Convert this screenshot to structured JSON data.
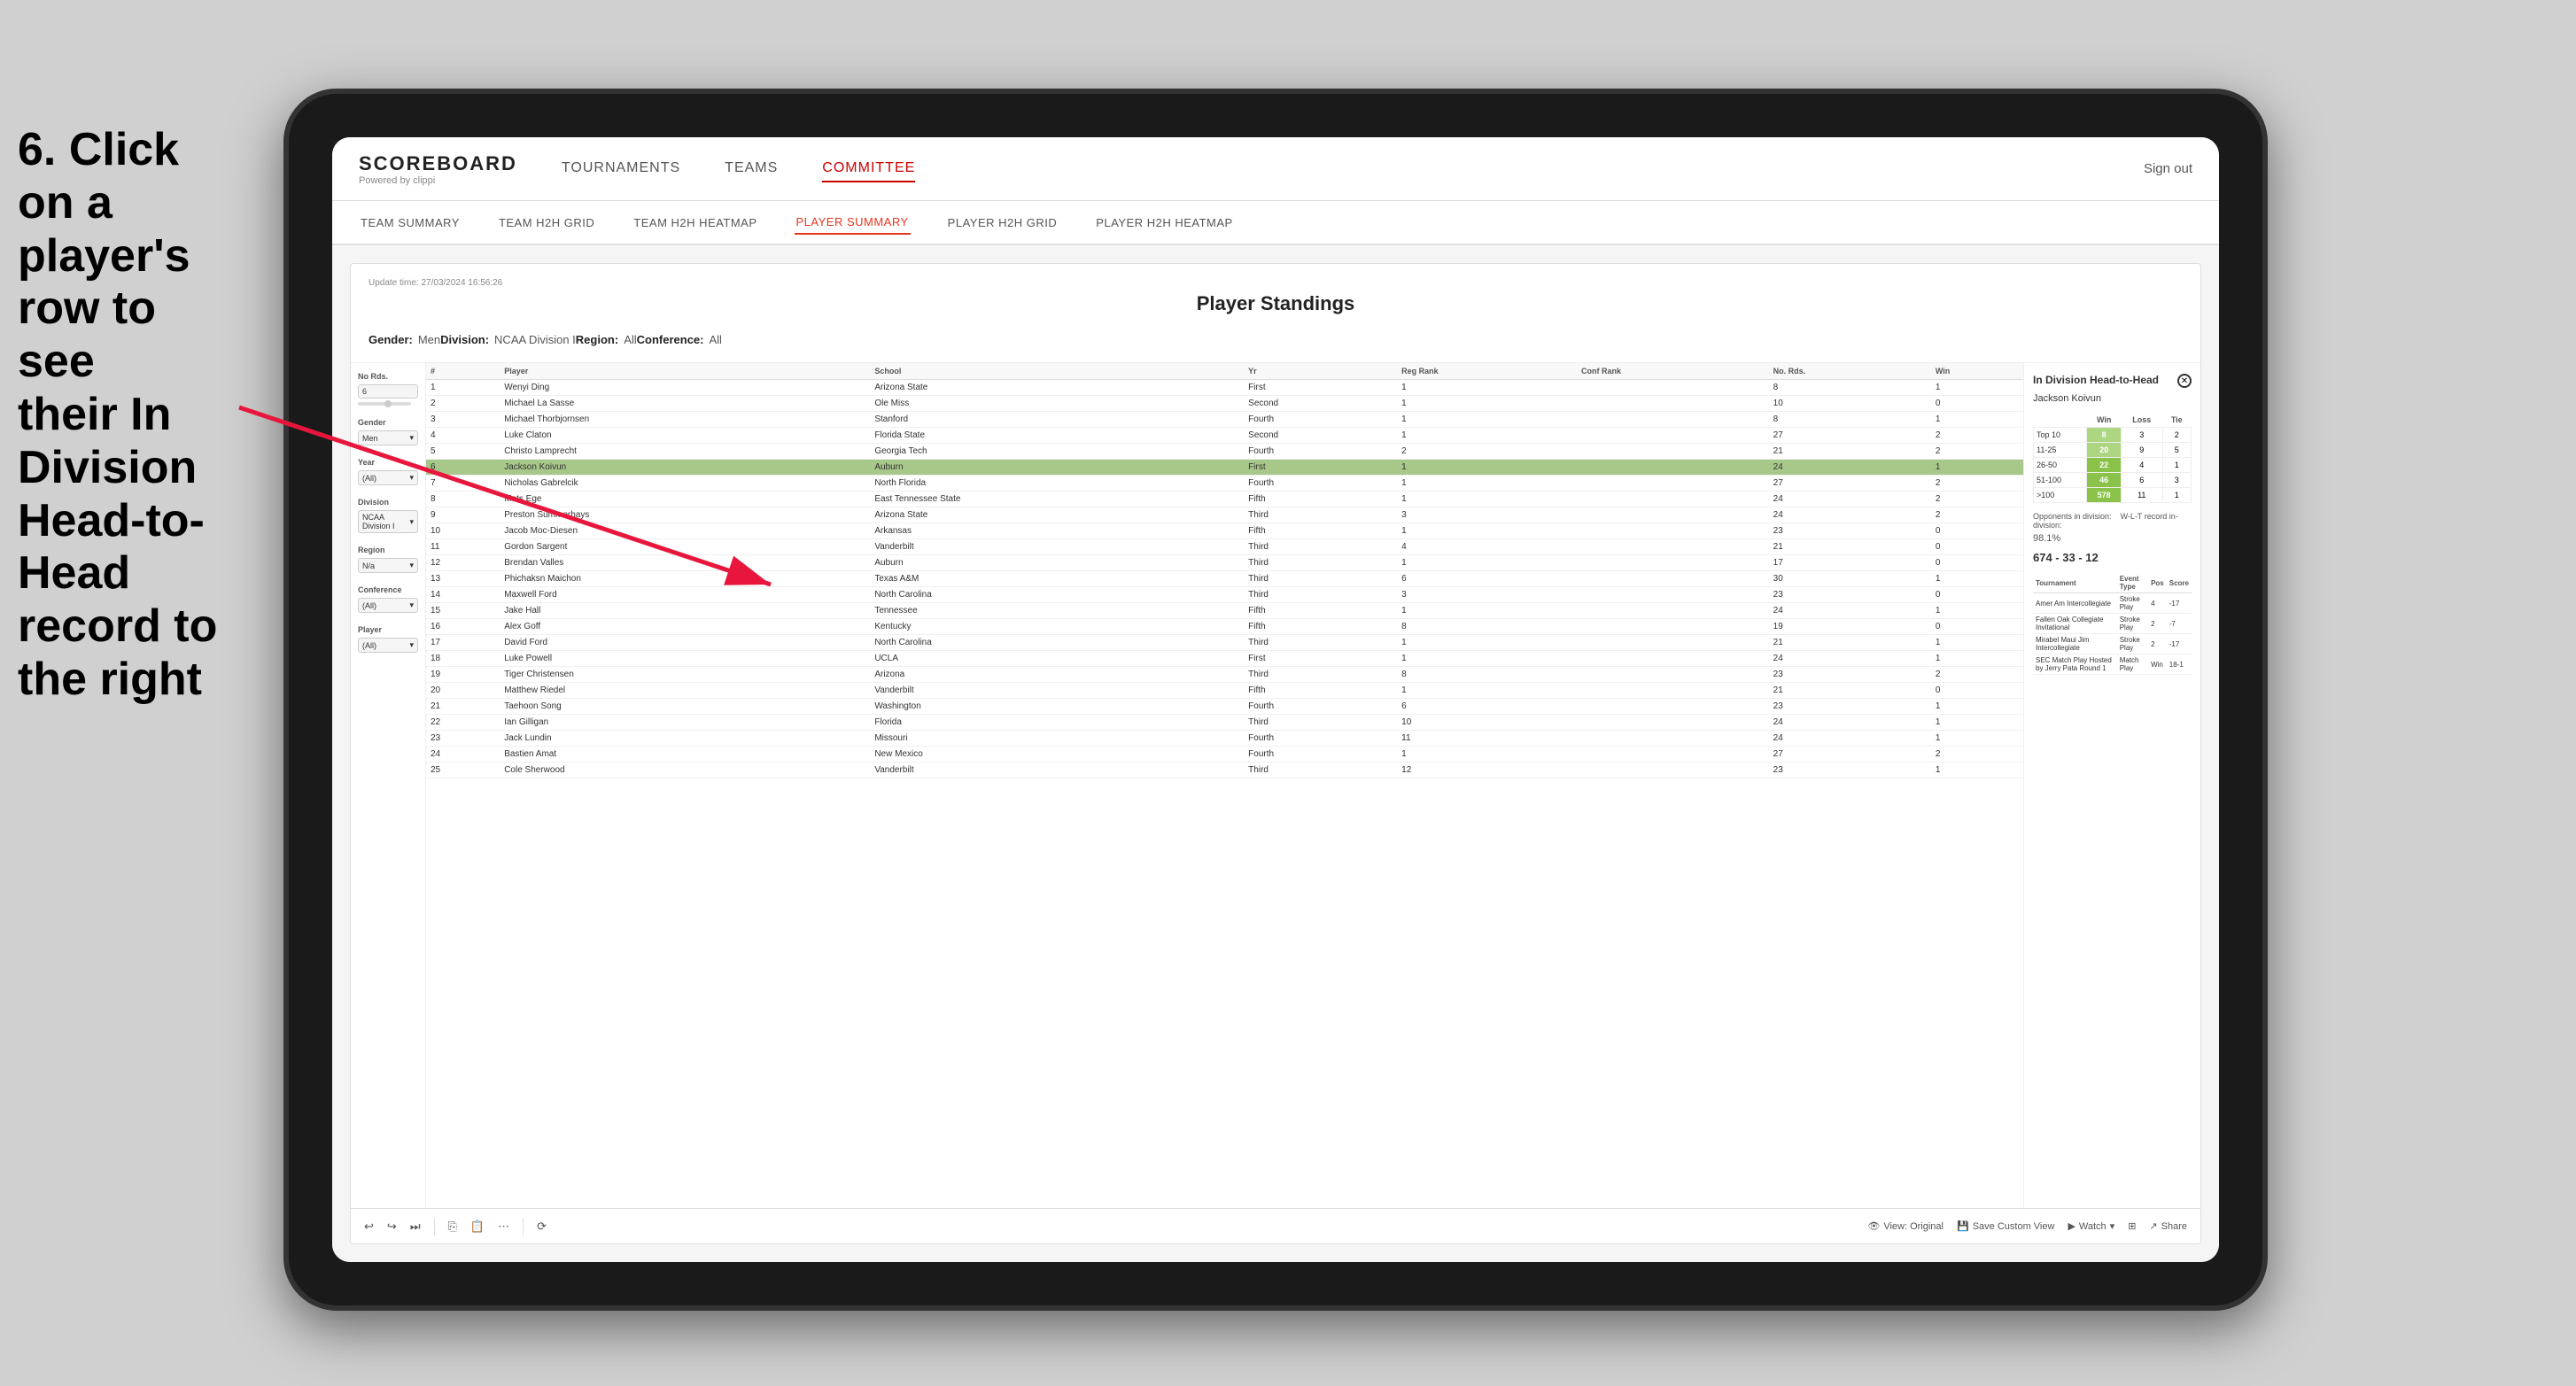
{
  "instruction": {
    "line1": "6. Click on a",
    "line2": "player's row to see",
    "line3": "their In Division",
    "line4": "Head-to-Head",
    "line5": "record to the right"
  },
  "nav": {
    "logo": "SCOREBOARD",
    "logo_sub": "Powered by clippi",
    "items": [
      "TOURNAMENTS",
      "TEAMS",
      "COMMITTEE"
    ],
    "sign_out": "Sign out"
  },
  "sub_nav": {
    "items": [
      "TEAM SUMMARY",
      "TEAM H2H GRID",
      "TEAM H2H HEATMAP",
      "PLAYER SUMMARY",
      "PLAYER H2H GRID",
      "PLAYER H2H HEATMAP"
    ]
  },
  "dashboard": {
    "update_time": "Update time:",
    "update_date": "27/03/2024 16:56:26",
    "title": "Player Standings",
    "gender_label": "Gender:",
    "gender_value": "Men",
    "division_label": "Division:",
    "division_value": "NCAA Division I",
    "region_label": "Region:",
    "region_value": "All",
    "conference_label": "Conference:",
    "conference_value": "All"
  },
  "sidebar": {
    "no_rds_label": "No Rds.",
    "no_rds_value": "6",
    "gender_label": "Gender",
    "gender_value": "Men",
    "year_label": "Year",
    "year_value": "(All)",
    "division_label": "Division",
    "division_value": "NCAA Division I",
    "region_label": "Region",
    "region_value": "N/a",
    "conference_label": "Conference",
    "conference_value": "(All)",
    "player_label": "Player",
    "player_value": "(All)"
  },
  "table": {
    "headers": [
      "#",
      "Player",
      "School",
      "Yr",
      "Reg Rank",
      "Conf Rank",
      "No. Rds.",
      "Win"
    ],
    "rows": [
      {
        "rank": 1,
        "player": "Wenyi Ding",
        "school": "Arizona State",
        "yr": "First",
        "reg_rank": 1,
        "conf_rank": "",
        "no_rds": 8,
        "win": 1
      },
      {
        "rank": 2,
        "player": "Michael La Sasse",
        "school": "Ole Miss",
        "yr": "Second",
        "reg_rank": 1,
        "conf_rank": "",
        "no_rds": 10,
        "win": 0
      },
      {
        "rank": 3,
        "player": "Michael Thorbjornsen",
        "school": "Stanford",
        "yr": "Fourth",
        "reg_rank": 1,
        "conf_rank": "",
        "no_rds": 8,
        "win": 1
      },
      {
        "rank": 4,
        "player": "Luke Claton",
        "school": "Florida State",
        "yr": "Second",
        "reg_rank": 1,
        "conf_rank": "",
        "no_rds": 27,
        "win": 2
      },
      {
        "rank": 5,
        "player": "Christo Lamprecht",
        "school": "Georgia Tech",
        "yr": "Fourth",
        "reg_rank": 2,
        "conf_rank": "",
        "no_rds": 21,
        "win": 2
      },
      {
        "rank": 6,
        "player": "Jackson Koivun",
        "school": "Auburn",
        "yr": "First",
        "reg_rank": 1,
        "conf_rank": "",
        "no_rds": 24,
        "win": 1,
        "selected": true
      },
      {
        "rank": 7,
        "player": "Nicholas Gabrelcik",
        "school": "North Florida",
        "yr": "Fourth",
        "reg_rank": 1,
        "conf_rank": "",
        "no_rds": 27,
        "win": 2
      },
      {
        "rank": 8,
        "player": "Mats Ege",
        "school": "East Tennessee State",
        "yr": "Fifth",
        "reg_rank": 1,
        "conf_rank": "",
        "no_rds": 24,
        "win": 2
      },
      {
        "rank": 9,
        "player": "Preston Summerhays",
        "school": "Arizona State",
        "yr": "Third",
        "reg_rank": 3,
        "conf_rank": "",
        "no_rds": 24,
        "win": 2
      },
      {
        "rank": 10,
        "player": "Jacob Moc-Diesen",
        "school": "Arkansas",
        "yr": "Fifth",
        "reg_rank": 1,
        "conf_rank": "",
        "no_rds": 23,
        "win": 0
      },
      {
        "rank": 11,
        "player": "Gordon Sargent",
        "school": "Vanderbilt",
        "yr": "Third",
        "reg_rank": 4,
        "conf_rank": "",
        "no_rds": 21,
        "win": 0
      },
      {
        "rank": 12,
        "player": "Brendan Valles",
        "school": "Auburn",
        "yr": "Third",
        "reg_rank": 1,
        "conf_rank": "",
        "no_rds": 17,
        "win": 0
      },
      {
        "rank": 13,
        "player": "Phichaksn Maichon",
        "school": "Texas A&M",
        "yr": "Third",
        "reg_rank": 6,
        "conf_rank": "",
        "no_rds": 30,
        "win": 1
      },
      {
        "rank": 14,
        "player": "Maxwell Ford",
        "school": "North Carolina",
        "yr": "Third",
        "reg_rank": 3,
        "conf_rank": "",
        "no_rds": 23,
        "win": 0
      },
      {
        "rank": 15,
        "player": "Jake Hall",
        "school": "Tennessee",
        "yr": "Fifth",
        "reg_rank": 1,
        "conf_rank": "",
        "no_rds": 24,
        "win": 1
      },
      {
        "rank": 16,
        "player": "Alex Goff",
        "school": "Kentucky",
        "yr": "Fifth",
        "reg_rank": 8,
        "conf_rank": "",
        "no_rds": 19,
        "win": 0
      },
      {
        "rank": 17,
        "player": "David Ford",
        "school": "North Carolina",
        "yr": "Third",
        "reg_rank": 1,
        "conf_rank": "",
        "no_rds": 21,
        "win": 1
      },
      {
        "rank": 18,
        "player": "Luke Powell",
        "school": "UCLA",
        "yr": "First",
        "reg_rank": 1,
        "conf_rank": "",
        "no_rds": 24,
        "win": 1
      },
      {
        "rank": 19,
        "player": "Tiger Christensen",
        "school": "Arizona",
        "yr": "Third",
        "reg_rank": 8,
        "conf_rank": "",
        "no_rds": 23,
        "win": 2
      },
      {
        "rank": 20,
        "player": "Matthew Riedel",
        "school": "Vanderbilt",
        "yr": "Fifth",
        "reg_rank": 1,
        "conf_rank": "",
        "no_rds": 21,
        "win": 0
      },
      {
        "rank": 21,
        "player": "Taehoon Song",
        "school": "Washington",
        "yr": "Fourth",
        "reg_rank": 6,
        "conf_rank": "",
        "no_rds": 23,
        "win": 1
      },
      {
        "rank": 22,
        "player": "Ian Gilligan",
        "school": "Florida",
        "yr": "Third",
        "reg_rank": 10,
        "conf_rank": "",
        "no_rds": 24,
        "win": 1
      },
      {
        "rank": 23,
        "player": "Jack Lundin",
        "school": "Missouri",
        "yr": "Fourth",
        "reg_rank": 11,
        "conf_rank": "",
        "no_rds": 24,
        "win": 1
      },
      {
        "rank": 24,
        "player": "Bastien Amat",
        "school": "New Mexico",
        "yr": "Fourth",
        "reg_rank": 1,
        "conf_rank": "",
        "no_rds": 27,
        "win": 2
      },
      {
        "rank": 25,
        "player": "Cole Sherwood",
        "school": "Vanderbilt",
        "yr": "Third",
        "reg_rank": 12,
        "conf_rank": "",
        "no_rds": 23,
        "win": 1
      }
    ]
  },
  "h2h_panel": {
    "title": "In Division Head-to-Head",
    "player_name": "Jackson Koivun",
    "table": {
      "headers": [
        "Win",
        "Loss",
        "Tie"
      ],
      "rows": [
        {
          "label": "Top 10",
          "win": 8,
          "loss": 3,
          "tie": 2
        },
        {
          "label": "11-25",
          "win": 20,
          "loss": 9,
          "tie": 5
        },
        {
          "label": "26-50",
          "win": 22,
          "loss": 4,
          "tie": 1
        },
        {
          "label": "51-100",
          "win": 46,
          "loss": 6,
          "tie": 3
        },
        {
          "label": ">100",
          "win": 578,
          "loss": 11,
          "tie": 1
        }
      ]
    },
    "opponents_label": "Opponents in division:",
    "wlt_label": "W-L-T record in-division:",
    "percentage": "98.1%",
    "record": "674 - 33 - 12",
    "tournament_headers": [
      "Tournament",
      "Event Type",
      "Pos",
      "Score"
    ],
    "tournaments": [
      {
        "name": "Amer Am Intercollegiate",
        "type": "Stroke Play",
        "pos": 4,
        "score": "-17"
      },
      {
        "name": "Fallen Oak Collegiate Invitational",
        "type": "Stroke Play",
        "pos": 2,
        "score": "-7"
      },
      {
        "name": "Mirabel Maui Jim Intercollegiate",
        "type": "Stroke Play",
        "pos": 2,
        "score": "-17"
      },
      {
        "name": "SEC Match Play Hosted by Jerry Pate Round 1",
        "type": "Match Play",
        "pos": "Win",
        "score": "18-1"
      }
    ]
  },
  "toolbar": {
    "icons": [
      "undo",
      "redo",
      "skip",
      "copy",
      "paste",
      "more",
      "separator",
      "refresh"
    ],
    "view_original": "View: Original",
    "save_custom": "Save Custom View",
    "watch": "Watch",
    "share": "Share"
  }
}
